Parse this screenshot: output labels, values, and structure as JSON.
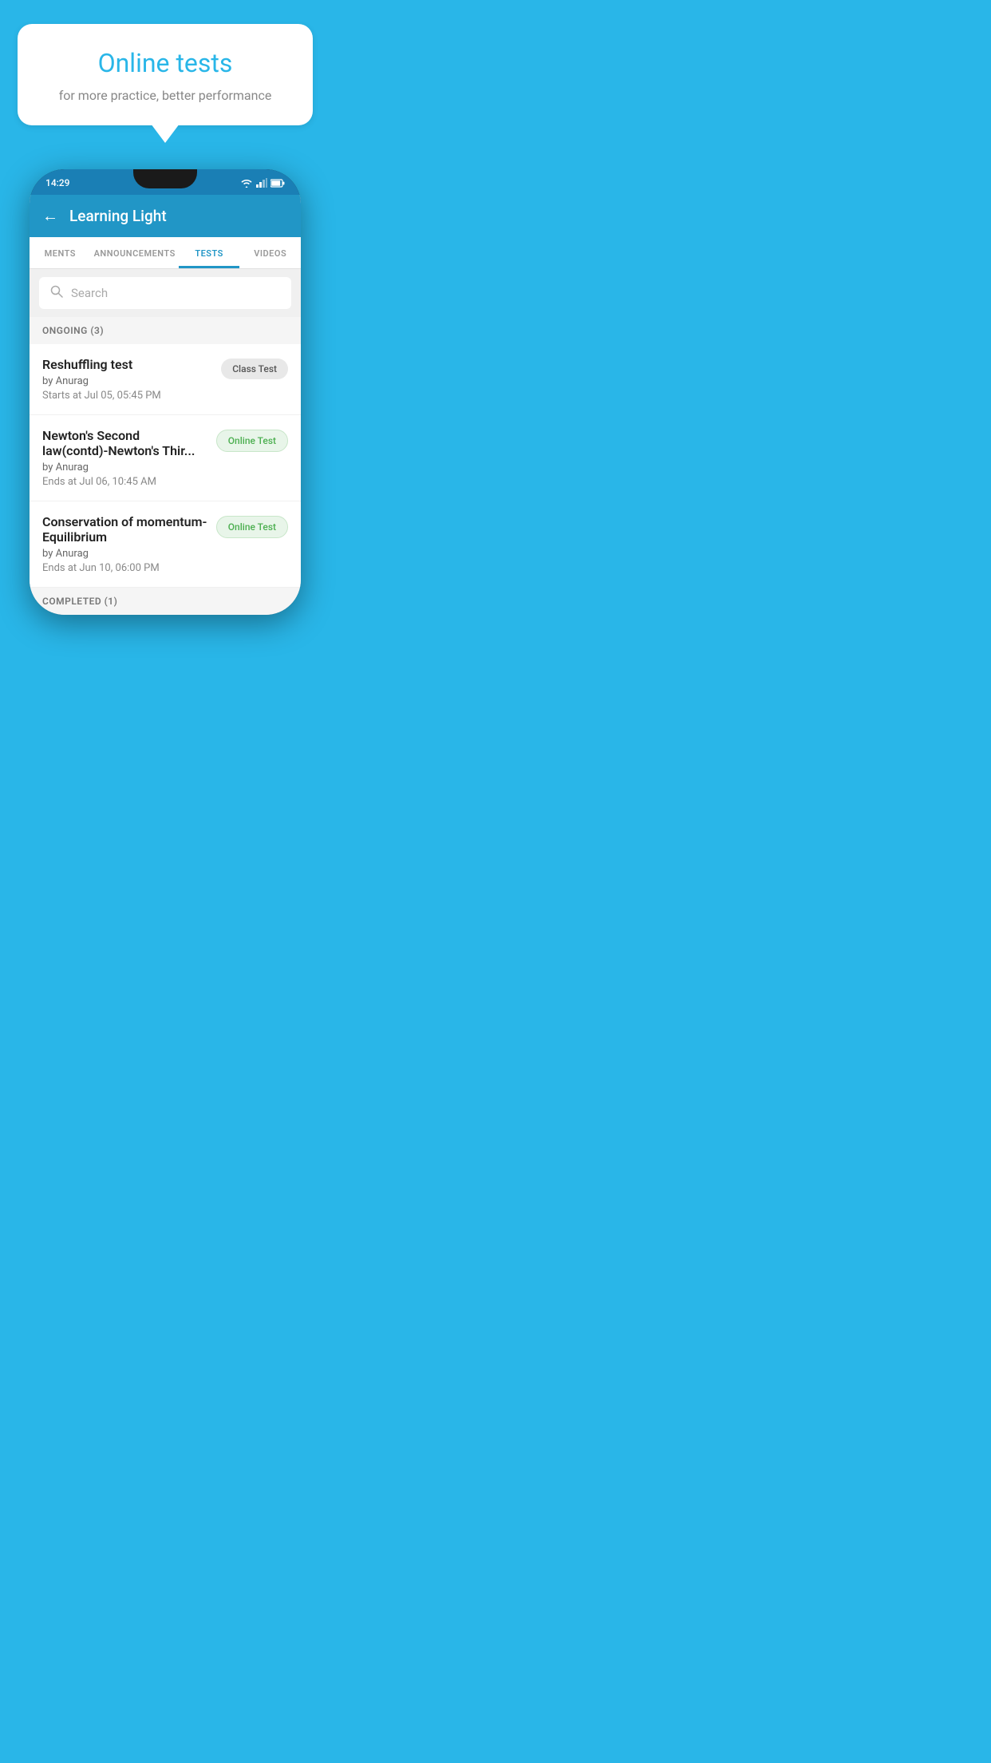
{
  "background_color": "#29b6e8",
  "bubble": {
    "title": "Online tests",
    "subtitle": "for more practice, better performance"
  },
  "phone": {
    "status_bar": {
      "time": "14:29"
    },
    "header": {
      "title": "Learning Light",
      "back_label": "←"
    },
    "tabs": [
      {
        "label": "MENTS",
        "active": false
      },
      {
        "label": "ANNOUNCEMENTS",
        "active": false
      },
      {
        "label": "TESTS",
        "active": true
      },
      {
        "label": "VIDEOS",
        "active": false
      }
    ],
    "search": {
      "placeholder": "Search"
    },
    "ongoing_section": {
      "label": "ONGOING (3)"
    },
    "tests": [
      {
        "name": "Reshuffling test",
        "author": "by Anurag",
        "date": "Starts at  Jul 05, 05:45 PM",
        "badge": "Class Test",
        "badge_type": "class"
      },
      {
        "name": "Newton's Second law(contd)-Newton's Thir...",
        "author": "by Anurag",
        "date": "Ends at  Jul 06, 10:45 AM",
        "badge": "Online Test",
        "badge_type": "online"
      },
      {
        "name": "Conservation of momentum-Equilibrium",
        "author": "by Anurag",
        "date": "Ends at  Jun 10, 06:00 PM",
        "badge": "Online Test",
        "badge_type": "online"
      }
    ],
    "completed_section": {
      "label": "COMPLETED (1)"
    }
  }
}
